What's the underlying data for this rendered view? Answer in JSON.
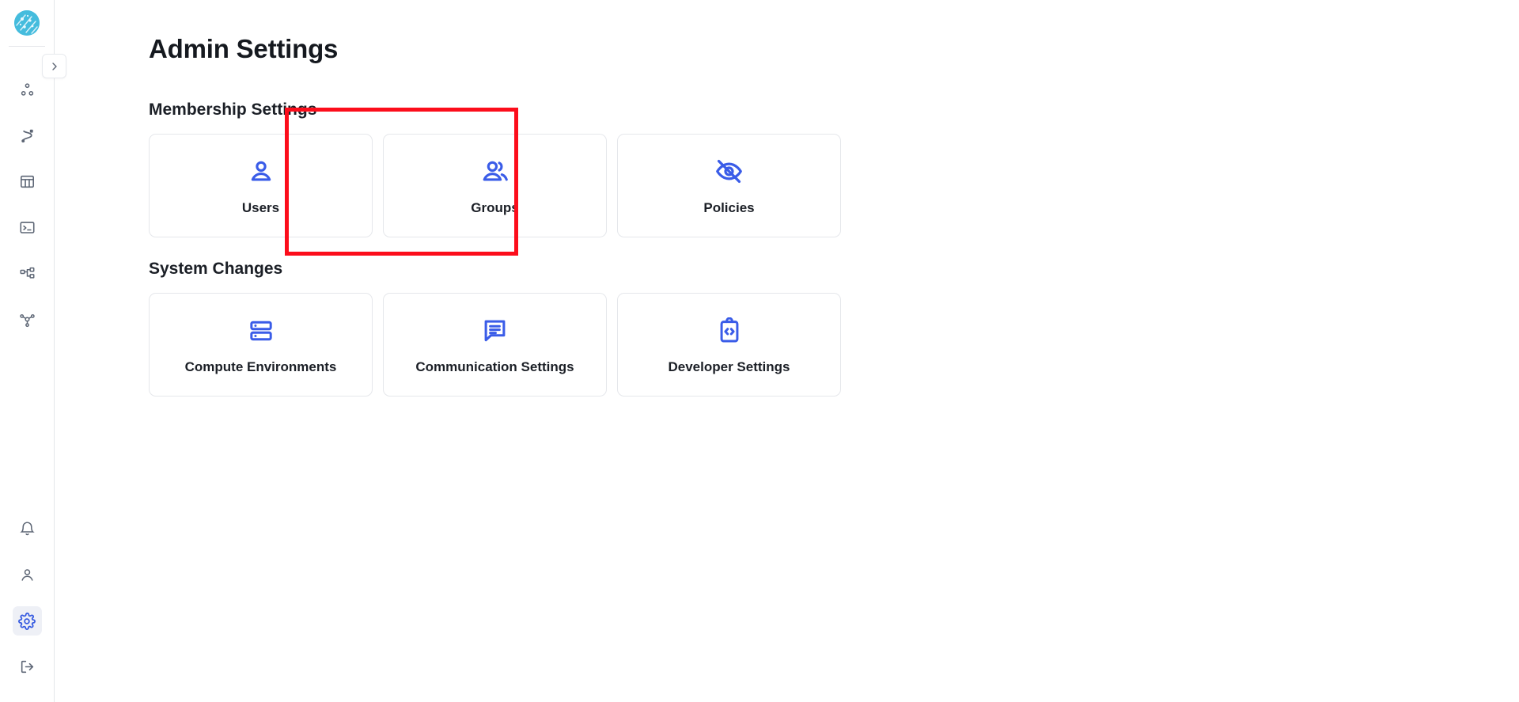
{
  "app": {
    "logo_name": "circuit-globe-logo"
  },
  "sidebar": {
    "collapse_button_label": "›",
    "top_items": [
      {
        "name": "sidebar-item-pipelines",
        "icon": "nodes-icon",
        "tooltip": "Pipelines"
      },
      {
        "name": "sidebar-item-runs",
        "icon": "route-icon",
        "tooltip": "Runs"
      },
      {
        "name": "sidebar-item-tables",
        "icon": "table-icon",
        "tooltip": "Tables"
      },
      {
        "name": "sidebar-item-terminal",
        "icon": "terminal-icon",
        "tooltip": "Terminal"
      },
      {
        "name": "sidebar-item-workflows",
        "icon": "sitemap-icon",
        "tooltip": "Workflows"
      },
      {
        "name": "sidebar-item-network",
        "icon": "network-hub-icon",
        "tooltip": "Network"
      }
    ],
    "bottom_items": [
      {
        "name": "sidebar-item-notifications",
        "icon": "bell-icon",
        "tooltip": "Notifications",
        "active": false
      },
      {
        "name": "sidebar-item-account",
        "icon": "person-icon",
        "tooltip": "Account",
        "active": false
      },
      {
        "name": "sidebar-item-settings",
        "icon": "gear-icon",
        "tooltip": "Settings",
        "active": true
      },
      {
        "name": "sidebar-item-logout",
        "icon": "logout-icon",
        "tooltip": "Log out",
        "active": false
      }
    ]
  },
  "main": {
    "page_title": "Admin Settings",
    "sections": [
      {
        "title": "Membership Settings",
        "cards": [
          {
            "label": "Users",
            "icon": "person-icon"
          },
          {
            "label": "Groups",
            "icon": "people-group-icon"
          },
          {
            "label": "Policies",
            "icon": "eye-off-icon"
          }
        ]
      },
      {
        "title": "System Changes",
        "cards": [
          {
            "label": "Compute Environments",
            "icon": "server-storage-icon"
          },
          {
            "label": "Communication Settings",
            "icon": "chat-bubble-icon"
          },
          {
            "label": "Developer Settings",
            "icon": "clipboard-code-icon"
          }
        ]
      }
    ]
  },
  "annotation": {
    "highlight_target": "Groups",
    "highlight_color": "#fc0d1b"
  }
}
